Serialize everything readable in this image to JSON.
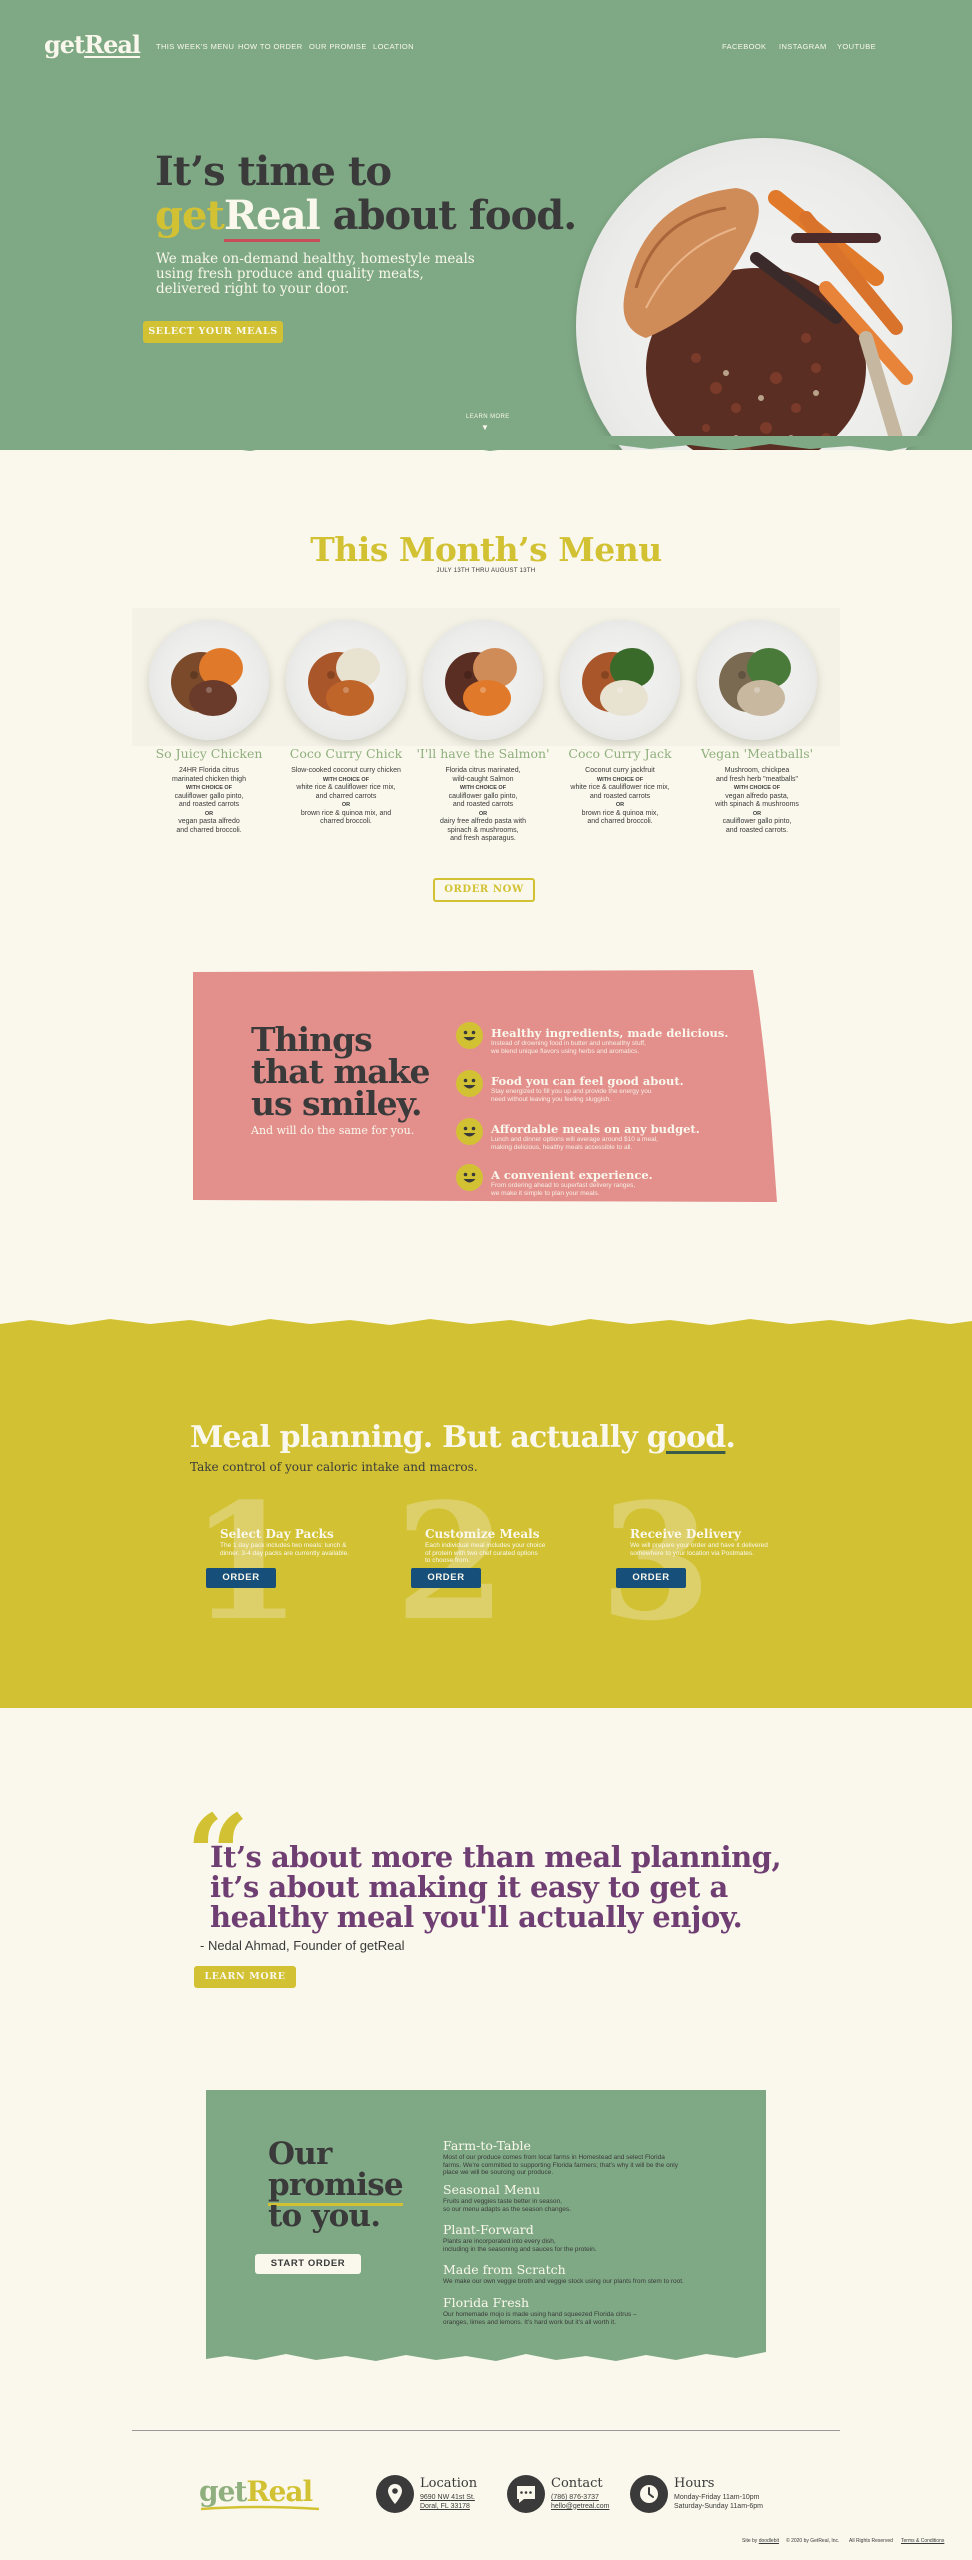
{
  "brand": {
    "logo_get": "get",
    "logo_real": "Real"
  },
  "nav": {
    "left": [
      "THIS WEEK'S MENU",
      "HOW TO ORDER",
      "OUR PROMISE",
      "LOCATION"
    ],
    "right": [
      "FACEBOOK",
      "INSTAGRAM",
      "YOUTUBE"
    ]
  },
  "hero": {
    "line1": "It’s time to",
    "get": "get",
    "real": "Real",
    "line2_rest": " about food.",
    "subtitle_lines": [
      "We make on-demand healthy, homestyle meals",
      "using fresh produce and quality meats,",
      "delivered right to your door."
    ],
    "cta": "SELECT YOUR MEALS",
    "learn_more": "LEARN MORE"
  },
  "menu": {
    "title": "This Month’s Menu",
    "dates": "JULY 13TH THRU AUGUST 13TH",
    "dishes": [
      {
        "name": "So Juicy Chicken",
        "desc": [
          "24HR Florida citrus",
          "marinated chicken thigh"
        ],
        "choice": "WITH CHOICE OF",
        "opt1": [
          "cauliflower gallo pinto,",
          "and roasted carrots"
        ],
        "or": "OR",
        "opt2": [
          "vegan pasta alfredo",
          "and charred broccoli."
        ]
      },
      {
        "name": "Coco Curry Chick",
        "desc": [
          "Slow-cooked coconut curry chicken"
        ],
        "choice": "WITH CHOICE OF",
        "opt1": [
          "white rice & cauliflower rice mix,",
          "and charred carrots"
        ],
        "or": "OR",
        "opt2": [
          "brown rice & quinoa mix, and",
          "charred broccoli."
        ]
      },
      {
        "name": "'I'll have the Salmon'",
        "desc": [
          "Florida citrus marinated,",
          "wild-caught Salmon"
        ],
        "choice": "WITH CHOICE OF",
        "opt1": [
          "cauliflower gallo pinto,",
          "and roasted carrots"
        ],
        "or": "OR",
        "opt2": [
          "dairy free alfredo pasta with",
          "spinach & mushrooms,",
          "and fresh asparagus."
        ]
      },
      {
        "name": "Coco Curry Jack",
        "desc": [
          "Coconut curry jackfruit"
        ],
        "choice": "WITH CHOICE OF",
        "opt1": [
          "white rice & cauliflower rice mix,",
          "and roasted carrots"
        ],
        "or": "OR",
        "opt2": [
          "brown rice & quinoa mix,",
          "and charred broccoli."
        ]
      },
      {
        "name": "Vegan 'Meatballs'",
        "desc": [
          "Mushroom, chickpea",
          "and fresh herb \"meatballs\""
        ],
        "choice": "WITH CHOICE OF",
        "opt1": [
          "vegan alfredo pasta,",
          "with spinach & mushrooms"
        ],
        "or": "OR",
        "opt2": [
          "cauliflower gallo pinto,",
          "and roasted carrots."
        ]
      }
    ],
    "cta": "ORDER NOW"
  },
  "smiley": {
    "heading_lines": [
      "Things",
      "that make",
      "us smiley."
    ],
    "sub": "And will do the same for you.",
    "features": [
      {
        "title": "Healthy ingredients, made delicious.",
        "desc": [
          "Instead of drowning food in butter and unhealthy stuff,",
          "we blend unique flavors using herbs and aromatics."
        ]
      },
      {
        "title": "Food you can feel good about.",
        "desc": [
          "Stay energized to fill you up and provide the energy you",
          "need without leaving you feeling sluggish."
        ]
      },
      {
        "title": "Affordable meals on any budget.",
        "desc": [
          "Lunch and dinner options will average around $10 a meal,",
          "making delicious, healthy meals accessible to all."
        ]
      },
      {
        "title": "A convenient experience.",
        "desc": [
          "From ordering ahead to superfast delivery ranges,",
          "we make it simple to plan your meals."
        ]
      }
    ]
  },
  "planning": {
    "heading_pre": "Meal planning. But actually ",
    "heading_good": "good",
    "heading_post": ".",
    "sub": "Take control of your caloric intake and macros.",
    "steps": [
      {
        "num": "1",
        "title": "Select Day Packs",
        "desc": [
          "The 1 day pack includes two meals: lunch &",
          "dinner. 3-4 day packs are currently available."
        ],
        "cta": "ORDER"
      },
      {
        "num": "2",
        "title": "Customize Meals",
        "desc": [
          "Each individual meal includes your choice",
          "of protein with two chef curated options",
          "to choose from."
        ],
        "cta": "ORDER"
      },
      {
        "num": "3",
        "title": "Receive Delivery",
        "desc": [
          "We will prepare your order and have it delivered",
          "somewhere to your location via Postmates."
        ],
        "cta": "ORDER"
      }
    ]
  },
  "quote": {
    "mark": "“",
    "lines": [
      "It’s about more than meal planning,",
      "it’s about making it easy to get a",
      "healthy meal you'll actually enjoy."
    ],
    "by": "- Nedal Ahmad, Founder of getReal",
    "cta": "LEARN MORE"
  },
  "promise": {
    "heading_lines": [
      "Our",
      "promise",
      "to you."
    ],
    "cta": "START ORDER",
    "items": [
      {
        "title": "Farm-to-Table",
        "desc": [
          "Most of our produce comes from local farms in Homestead and select Florida",
          "farms. We're committed to supporting Florida farmers; that's why it will be the only",
          "place we will be sourcing our produce."
        ]
      },
      {
        "title": "Seasonal Menu",
        "desc": [
          "Fruits and veggies taste better in season,",
          "so our menu adapts as the season changes."
        ]
      },
      {
        "title": "Plant-Forward",
        "desc": [
          "Plants are incorporated into every dish,",
          "including in the seasoning and sauces for the protein."
        ]
      },
      {
        "title": "Made from Scratch",
        "desc": [
          "We make our own veggie broth and veggie stock using our plants from stem to root."
        ]
      },
      {
        "title": "Florida Fresh",
        "desc": [
          "Our homemade mojo is made using hand squeezed Florida citrus –",
          "oranges, limes and lemons. It's hard work but it's all worth it."
        ]
      }
    ]
  },
  "footer": {
    "location": {
      "title": "Location",
      "lines": [
        "9690 NW 41st St.",
        "Doral, FL 33178"
      ]
    },
    "contact": {
      "title": "Contact",
      "lines": [
        "(786) 876-3737",
        "hello@getreal.com"
      ]
    },
    "hours": {
      "title": "Hours",
      "lines": [
        "Monday-Friday 11am-10pm",
        "Saturday-Sunday 11am-6pm"
      ]
    },
    "bottom": [
      "Site by ",
      "doodlebit",
      "© 2020 by GetReal, Inc.",
      "All Rights Reserved",
      "Terms & Conditions"
    ]
  },
  "colors": {
    "green": "#7FA985",
    "yellow": "#D2C233",
    "pink": "#E3908D",
    "purple": "#6F3E72",
    "cream": "#FAF8EC",
    "dark": "#3a3a3a",
    "blue": "#16507A"
  }
}
